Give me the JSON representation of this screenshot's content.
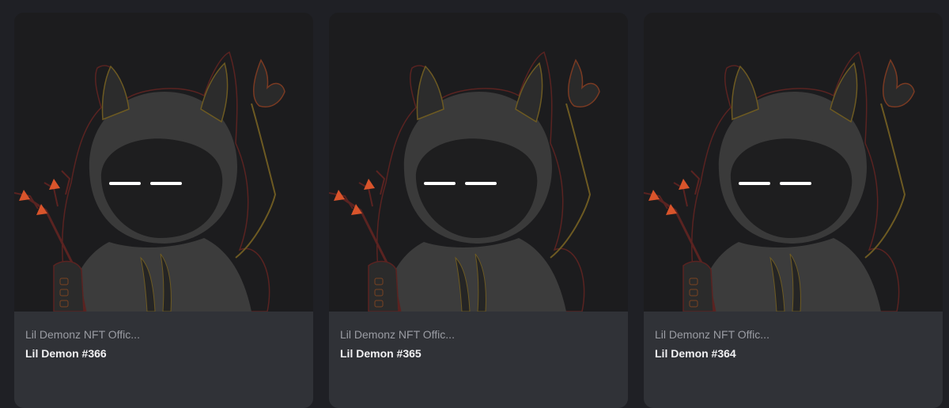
{
  "cards": [
    {
      "collection": "Lil Demonz NFT Offic...",
      "title": "Lil Demon #366"
    },
    {
      "collection": "Lil Demonz NFT Offic...",
      "title": "Lil Demon #365"
    },
    {
      "collection": "Lil Demonz NFT Offic...",
      "title": "Lil Demon #364"
    }
  ]
}
